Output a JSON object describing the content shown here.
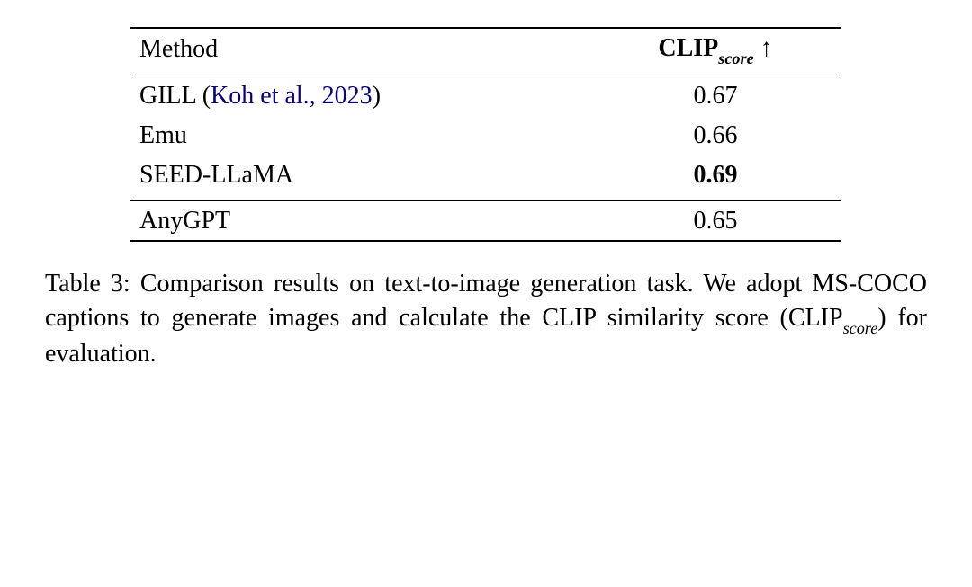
{
  "table": {
    "header_method": "Method",
    "header_score_prefix": "CLIP",
    "header_score_sub": "score",
    "header_score_arrow": "↑",
    "rows_group1": [
      {
        "method": "GILL",
        "cite_open": "  (",
        "cite_text": "Koh et al., 2023",
        "cite_close": ")",
        "score": "0.67",
        "bold": false
      },
      {
        "method": "Emu",
        "cite_open": "",
        "cite_text": "",
        "cite_close": "",
        "score": "0.66",
        "bold": false
      },
      {
        "method": "SEED-LLaMA",
        "cite_open": "",
        "cite_text": "",
        "cite_close": "",
        "score": "0.69",
        "bold": true
      }
    ],
    "rows_group2": [
      {
        "method": "AnyGPT",
        "cite_open": "",
        "cite_text": "",
        "cite_close": "",
        "score": "0.65",
        "bold": false
      }
    ]
  },
  "caption": {
    "label": "Table 3:",
    "text_before": " Comparison results on text-to-image generation task. We adopt MS-COCO captions to generate images and calculate the CLIP similarity score (CLIP",
    "sub": "score",
    "text_after": ") for evaluation."
  },
  "chart_data": {
    "type": "table",
    "title": "Table 3: Comparison results on text-to-image generation task (CLIP_score ↑)",
    "columns": [
      "Method",
      "CLIP_score"
    ],
    "rows": [
      [
        "GILL (Koh et al., 2023)",
        0.67
      ],
      [
        "Emu",
        0.66
      ],
      [
        "SEED-LLaMA",
        0.69
      ],
      [
        "AnyGPT",
        0.65
      ]
    ],
    "higher_is_better": true,
    "best_row_index": 2
  }
}
